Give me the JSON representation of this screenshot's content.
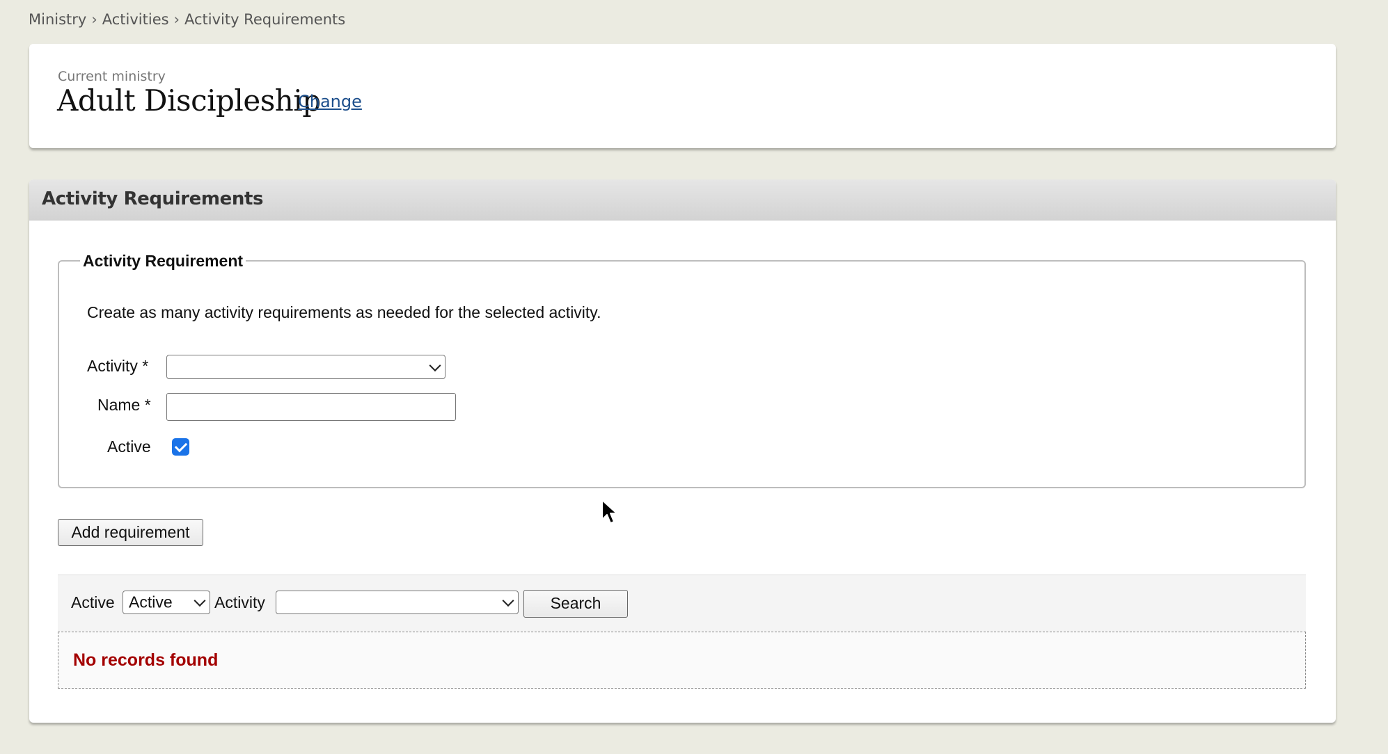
{
  "breadcrumb": {
    "items": [
      "Ministry",
      "Activities",
      "Activity Requirements"
    ],
    "separator": "›"
  },
  "ministry": {
    "label": "Current ministry",
    "name": "Adult Discipleship",
    "change_link": "Change"
  },
  "panel": {
    "title": "Activity Requirements"
  },
  "form": {
    "legend": "Activity Requirement",
    "description": "Create as many activity requirements as needed for the selected activity.",
    "activity_label": "Activity *",
    "activity_value": "",
    "name_label": "Name *",
    "name_value": "",
    "active_label": "Active",
    "active_checked": true,
    "add_button": "Add requirement"
  },
  "filter": {
    "active_label": "Active",
    "active_value": "Active",
    "activity_label": "Activity",
    "activity_value": "",
    "search_button": "Search"
  },
  "results": {
    "empty_message": "No records found"
  },
  "colors": {
    "background": "#ebebe1",
    "link": "#1d4f8c",
    "error_text": "#a30000",
    "checkbox": "#1a73e8"
  }
}
